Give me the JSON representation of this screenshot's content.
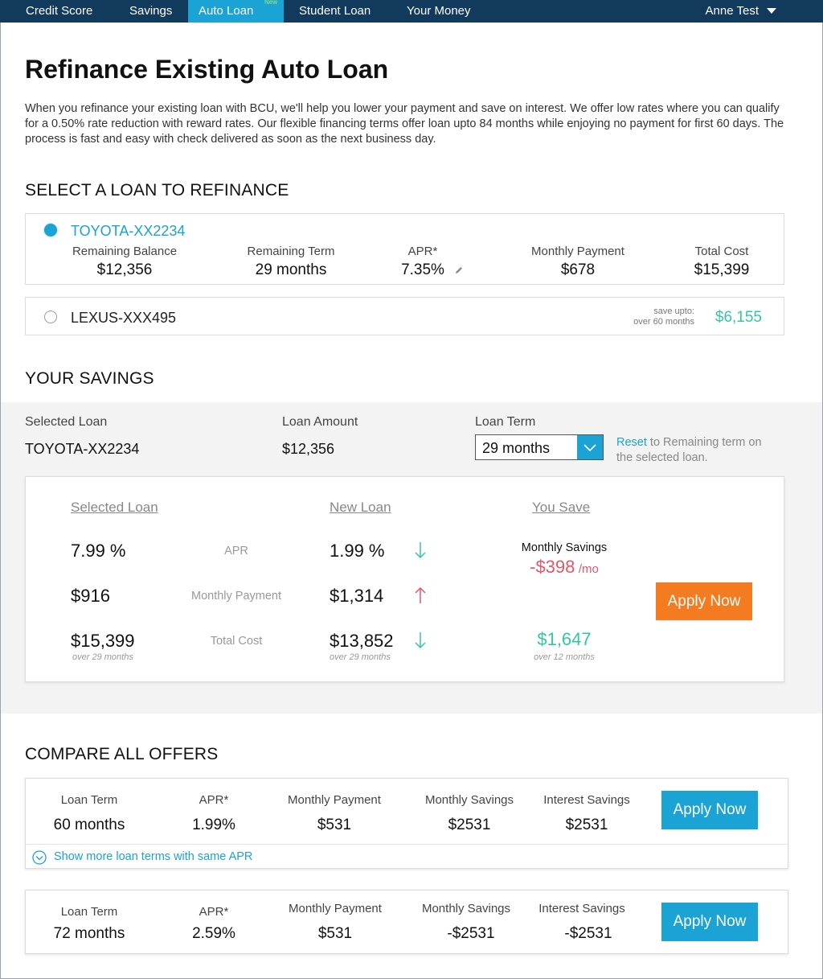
{
  "nav": {
    "items": [
      {
        "label": "Credit Score"
      },
      {
        "label": "Savings"
      },
      {
        "label": "Auto Loan",
        "badge": "New",
        "active": true
      },
      {
        "label": "Student Loan"
      },
      {
        "label": "Your Money"
      }
    ],
    "user": "Anne Test"
  },
  "page": {
    "title": "Refinance Existing Auto Loan",
    "intro": "When you refinance your existing loan with BCU, we'll help you lower your payment and save on interest. We offer low rates where you can qualify for a 0.50% rate reduction with reward rates. Our flexible financing terms offer loan upto 84 months while enjoying no payment for first 60 days. The process is fast and easy with check delivered as soon as the next business day."
  },
  "select_section": {
    "title": "SELECT A LOAN TO REFINANCE",
    "loans": [
      {
        "name": "TOYOTA-XX2234",
        "selected": true,
        "remaining_balance_label": "Remaining Balance",
        "remaining_balance": "$12,356",
        "remaining_term_label": "Remaining Term",
        "remaining_term": "29 months",
        "apr_label": "APR*",
        "apr": "7.35%",
        "monthly_payment_label": "Monthly Payment",
        "monthly_payment": "$678",
        "total_cost_label": "Total Cost",
        "total_cost": "$15,399"
      },
      {
        "name": "LEXUS-XXX495",
        "selected": false,
        "save_upto_line1": "save upto:",
        "save_upto_line2": "over 60 months",
        "save_amount": "$6,155"
      }
    ]
  },
  "savings": {
    "title": "YOUR SAVINGS",
    "selected_loan_label": "Selected Loan",
    "selected_loan": "TOYOTA-XX2234",
    "loan_amount_label": "Loan Amount",
    "loan_amount": "$12,356",
    "loan_term_label": "Loan Term",
    "loan_term_value": "29 months",
    "reset_link": "Reset",
    "reset_text": " to Remaining term on the selected loan.",
    "compare": {
      "col_selected": "Selected Loan",
      "col_new": "New Loan",
      "col_save": "You Save",
      "rows": [
        {
          "label": "APR",
          "selected": "7.99 %",
          "new": "1.99 %",
          "direction": "down"
        },
        {
          "label": "Monthly Payment",
          "selected": "$916",
          "new": "$1,314",
          "direction": "up"
        },
        {
          "label": "Total Cost",
          "selected": "$15,399",
          "selected_note": "over 29 months",
          "new": "$13,852",
          "new_note": "over 29 months",
          "direction": "down"
        }
      ],
      "monthly_savings_label": "Monthly Savings",
      "monthly_savings": "-$398",
      "monthly_savings_unit": "/mo",
      "total_savings": "$1,647",
      "total_savings_note": "over 12 months",
      "apply_label": "Apply Now"
    }
  },
  "offers": {
    "title": "COMPARE ALL OFFERS",
    "labels": {
      "loan_term": "Loan Term",
      "apr": "APR*",
      "monthly_payment": "Monthly Payment",
      "monthly_savings": "Monthly Savings",
      "interest_savings": "Interest Savings"
    },
    "items": [
      {
        "loan_term": "60 months",
        "apr": "1.99%",
        "monthly_payment": "$531",
        "monthly_savings": "$2531",
        "interest_savings": "$2531",
        "apply_label": "Apply Now",
        "show_more": "Show more loan terms with same APR"
      },
      {
        "loan_term": "72 months",
        "apr": "2.59%",
        "monthly_payment": "$531",
        "monthly_savings": "-$2531",
        "interest_savings": "-$2531",
        "apply_label": "Apply Now"
      }
    ]
  },
  "colors": {
    "nav_bg": "#123a5c",
    "accent_blue": "#1aa3d4",
    "positive_green": "#33c7a0",
    "negative_red": "#e5566b",
    "cta_orange": "#f47b20"
  }
}
